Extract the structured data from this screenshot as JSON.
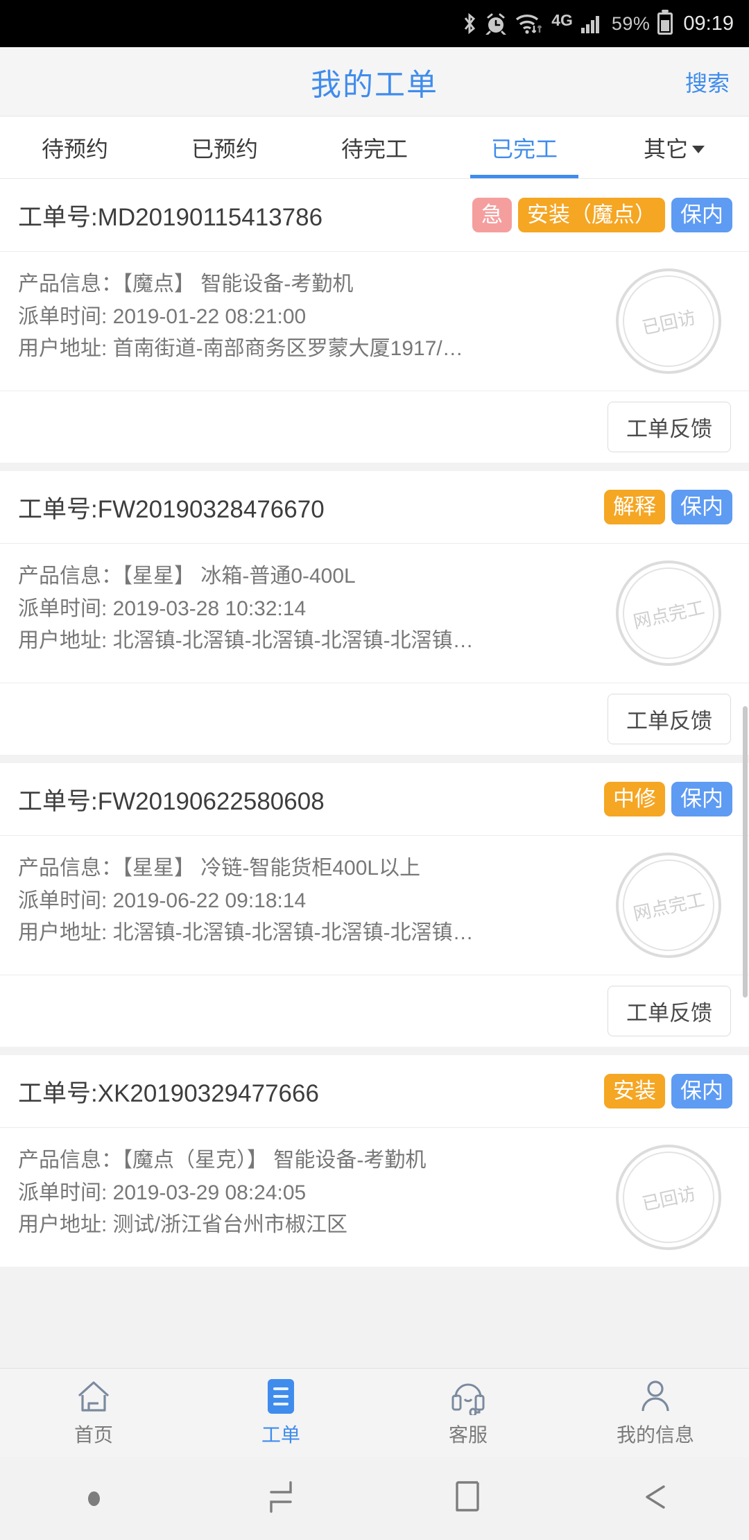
{
  "statusbar": {
    "icons": [
      "bluetooth-icon",
      "alarm-icon",
      "wifi-icon"
    ],
    "network": "4G",
    "battery_percent": "59%",
    "clock": "09:19"
  },
  "header": {
    "title": "我的工单",
    "search_label": "搜索"
  },
  "tabs": [
    {
      "label": "待预约",
      "active": false,
      "caret": false
    },
    {
      "label": "已预约",
      "active": false,
      "caret": false
    },
    {
      "label": "待完工",
      "active": false,
      "caret": false
    },
    {
      "label": "已完工",
      "active": true,
      "caret": false
    },
    {
      "label": "其它",
      "active": false,
      "caret": true
    }
  ],
  "labels": {
    "order_prefix": "工单号:",
    "product_label": "产品信息：",
    "dispatch_label": "派单时间:",
    "address_label": "用户地址:",
    "feedback_button": "工单反馈"
  },
  "orders": [
    {
      "order_no": "工单号:MD20190115413786",
      "tags": [
        {
          "text": "急",
          "style": "urgent"
        },
        {
          "text": "安装（魔点）",
          "style": "type"
        },
        {
          "text": "保内",
          "style": "warr"
        }
      ],
      "product": "产品信息：【魔点】 智能设备-考勤机",
      "dispatch": "派单时间: 2019-01-22 08:21:00",
      "address": "用户地址: 首南街道-南部商务区罗蒙大厦1917/浙江...",
      "stamp": "已回访",
      "feedback": "工单反馈"
    },
    {
      "order_no": "工单号:FW20190328476670",
      "tags": [
        {
          "text": "解释",
          "style": "type"
        },
        {
          "text": "保内",
          "style": "warr"
        }
      ],
      "product": "产品信息：【星星】 冰箱-普通0-400L",
      "dispatch": "派单时间: 2019-03-28 10:32:14",
      "address": "用户地址: 北滘镇-北滘镇-北滘镇-北滘镇-北滘镇-北滘...",
      "stamp": "网点完工",
      "feedback": "工单反馈"
    },
    {
      "order_no": "工单号:FW20190622580608",
      "tags": [
        {
          "text": "中修",
          "style": "type"
        },
        {
          "text": "保内",
          "style": "warr"
        }
      ],
      "product": "产品信息：【星星】 冷链-智能货柜400L以上",
      "dispatch": "派单时间: 2019-06-22 09:18:14",
      "address": "用户地址: 北滘镇-北滘镇-北滘镇-北滘镇-北滘镇-北滘...",
      "stamp": "网点完工",
      "feedback": "工单反馈"
    },
    {
      "order_no": "工单号:XK20190329477666",
      "tags": [
        {
          "text": "安装",
          "style": "type"
        },
        {
          "text": "保内",
          "style": "warr"
        }
      ],
      "product": "产品信息：【魔点（星克）】 智能设备-考勤机",
      "dispatch": "派单时间: 2019-03-29 08:24:05",
      "address": "用户地址: 测试/浙江省台州市椒江区",
      "stamp": "已回访",
      "feedback": "工单反馈"
    }
  ],
  "bottom_nav": [
    {
      "label": "首页",
      "icon": "home-icon",
      "active": false
    },
    {
      "label": "工单",
      "icon": "orders-icon",
      "active": true
    },
    {
      "label": "客服",
      "icon": "headset-icon",
      "active": false
    },
    {
      "label": "我的信息",
      "icon": "person-icon",
      "active": false
    }
  ],
  "android_nav": [
    "dot-icon",
    "recents-icon",
    "home-square-icon",
    "back-arrow-icon"
  ],
  "colors": {
    "accent": "#3f8ced",
    "tag_urgent": "#f59e9e",
    "tag_type": "#f5a623",
    "tag_warranty": "#5e9bf2"
  }
}
